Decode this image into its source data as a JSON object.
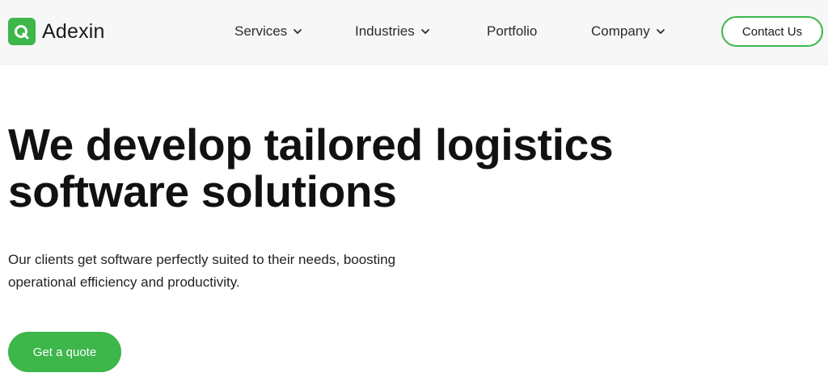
{
  "brand": {
    "name": "Adexin",
    "logo_icon": "adexin-logo-icon",
    "accent_color": "#3db64a"
  },
  "nav": {
    "items": [
      {
        "label": "Services",
        "has_dropdown": true
      },
      {
        "label": "Industries",
        "has_dropdown": true
      },
      {
        "label": "Portfolio",
        "has_dropdown": false
      },
      {
        "label": "Company",
        "has_dropdown": true
      }
    ],
    "dropdown_icon": "chevron-down-icon",
    "contact_label": "Contact Us"
  },
  "hero": {
    "title_line1": "We develop tailored logistics",
    "title_line2": "software solutions",
    "subtitle_line1": "Our clients get software perfectly suited to their needs, boosting",
    "subtitle_line2": "operational efficiency and productivity.",
    "cta_label": "Get a quote"
  }
}
